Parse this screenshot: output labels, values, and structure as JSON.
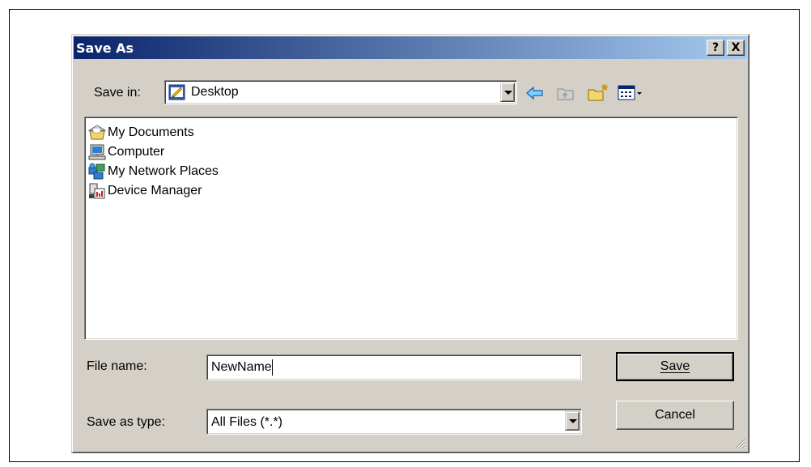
{
  "dialog": {
    "title": "Save As",
    "help_button": "?",
    "close_button": "X"
  },
  "save_in": {
    "label": "Save in:",
    "value": "Desktop",
    "icon": "desktop-icon"
  },
  "toolbar": {
    "icons": [
      "back-arrow-icon",
      "up-folder-icon",
      "new-folder-icon",
      "view-menu-icon"
    ]
  },
  "files": [
    {
      "label": "My Documents",
      "icon": "my-documents-icon"
    },
    {
      "label": "Computer",
      "icon": "computer-icon"
    },
    {
      "label": "My Network Places",
      "icon": "network-places-icon"
    },
    {
      "label": "Device Manager",
      "icon": "device-manager-icon"
    }
  ],
  "file_name": {
    "label": "File name:",
    "value": "NewName"
  },
  "save_as_type": {
    "label": "Save as type:",
    "value": "All Files (*.*)"
  },
  "buttons": {
    "save": "Save",
    "cancel": "Cancel"
  }
}
